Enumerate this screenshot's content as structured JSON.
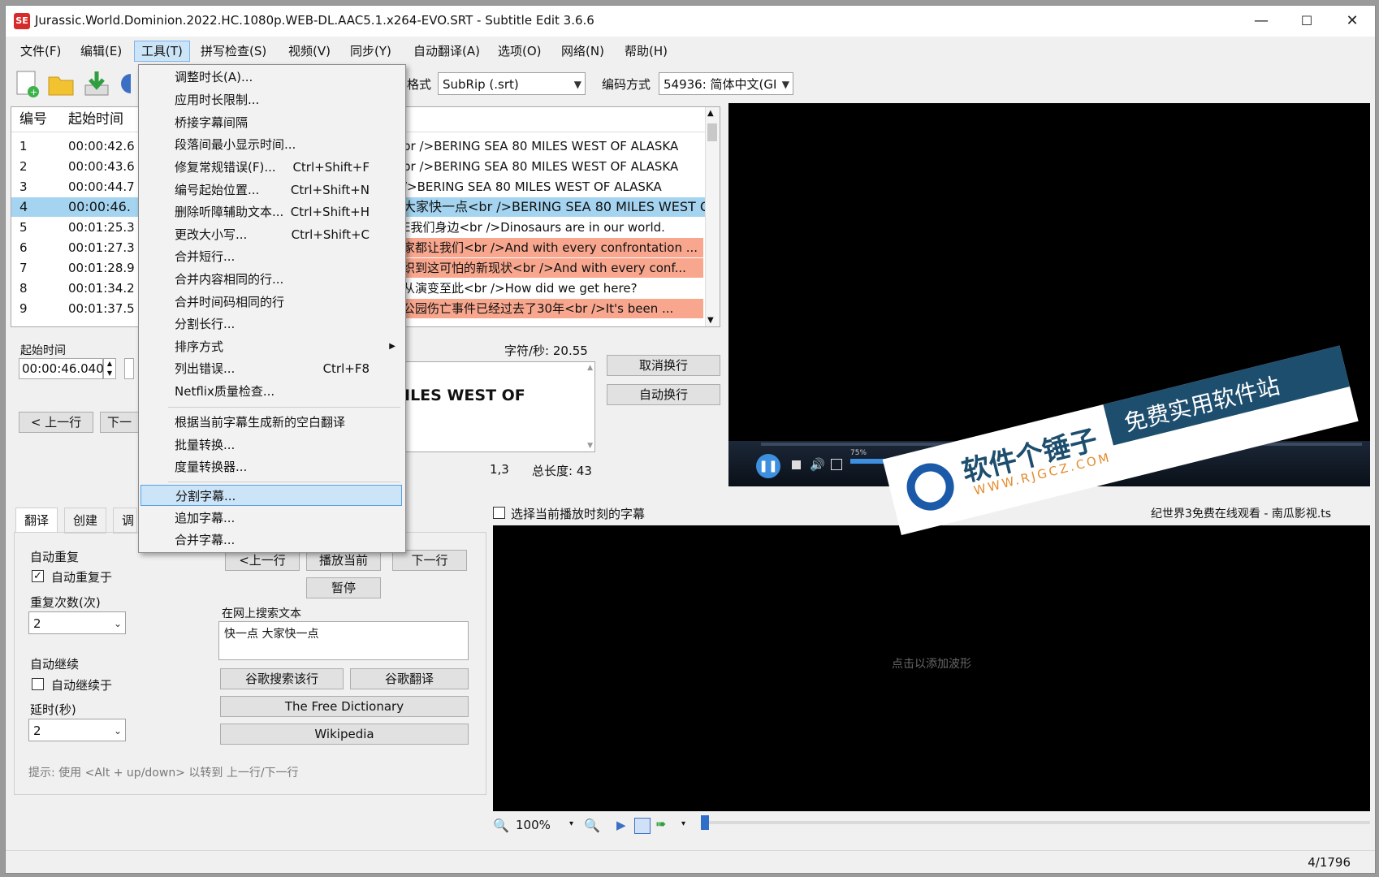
{
  "window": {
    "title": "Jurassic.World.Dominion.2022.HC.1080p.WEB-DL.AAC5.1.x264-EVO.SRT - Subtitle Edit 3.6.6",
    "app_icon_text": "SE",
    "minimize": "—",
    "maximize": "☐",
    "close": "✕"
  },
  "menubar": [
    "文件(F)",
    "编辑(E)",
    "工具(T)",
    "拼写检查(S)",
    "视频(V)",
    "同步(Y)",
    "自动翻译(A)",
    "选项(O)",
    "网络(N)",
    "帮助(H)"
  ],
  "toolbar": {
    "format_label": "格式",
    "format_value": "SubRip (.srt)",
    "encoding_label": "编码方式",
    "encoding_value": "54936: 简体中文(GI"
  },
  "grid": {
    "headers": [
      "编号",
      "起始时间"
    ],
    "rows": [
      {
        "num": "1",
        "start": "00:00:42.6",
        "text": "br />BERING SEA 80 MILES WEST OF ALASKA",
        "style": "normal"
      },
      {
        "num": "2",
        "start": "00:00:43.6",
        "text": "br />BERING SEA 80 MILES WEST OF ALASKA",
        "style": "normal"
      },
      {
        "num": "3",
        "start": "00:00:44.7",
        "text": "/>BERING SEA 80 MILES WEST OF ALASKA",
        "style": "normal"
      },
      {
        "num": "4",
        "start": "00:00:46.",
        "text": "大家快一点<br />BERING SEA 80 MILES WEST O",
        "style": "selected"
      },
      {
        "num": "5",
        "start": "00:01:25.3",
        "text": "E我们身边<br />Dinosaurs are in our world.",
        "style": "normal"
      },
      {
        "num": "6",
        "start": "00:01:27.3",
        "text": "家都让我们<br />And with every confrontation ...",
        "style": "red"
      },
      {
        "num": "7",
        "start": "00:01:28.9",
        "text": "织到这可怕的新现状<br />And with every conf...",
        "style": "red"
      },
      {
        "num": "8",
        "start": "00:01:34.2",
        "text": "从演变至此<br />How did we get here?",
        "style": "normal"
      },
      {
        "num": "9",
        "start": "00:01:37.5",
        "text": "公园伤亡事件已经过去了30年<br />It's been ...",
        "style": "red"
      }
    ]
  },
  "edit": {
    "start_label": "起始时间",
    "start_value": "00:00:46.040",
    "chars_per_sec": "字符/秒: 20.55",
    "text_preview": "ILES WEST OF",
    "position": "1,3",
    "total_length": "总长度: 43",
    "unbreak_button": "取消换行",
    "autobreak_button": "自动换行",
    "prev_button": "< 上一行",
    "next_button": "下一"
  },
  "tabs": [
    "翻译",
    "创建",
    "调"
  ],
  "translate": {
    "auto_repeat_title": "自动重复",
    "auto_repeat_check": "自动重复于",
    "repeat_count_label": "重复次数(次)",
    "repeat_count_value": "2",
    "auto_continue_title": "自动继续",
    "auto_continue_check": "自动继续于",
    "delay_label": "延时(秒)",
    "delay_value": "2",
    "prev_line": "<上一行",
    "play_current": "播放当前",
    "next_line": "下一行",
    "pause": "暂停",
    "search_web_title": "在网上搜索文本",
    "search_text": "快一点 大家快一点",
    "google_search": "谷歌搜索该行",
    "google_translate": "谷歌翻译",
    "free_dictionary": "The Free Dictionary",
    "wikipedia": "Wikipedia",
    "hint": "提示: 使用 <Alt + up/down> 以转到 上一行/下一行"
  },
  "waveform": {
    "select_current_label": "选择当前播放时刻的字幕",
    "file_name": "纪世界3免费在线观看 - 南瓜影视.ts",
    "click_to_add": "点击以添加波形",
    "zoom": "100%"
  },
  "status": {
    "position": "4/1796"
  },
  "video": {
    "volume_text": "75%"
  },
  "tools_menu": {
    "items": [
      {
        "label": "调整时长(A)...",
        "shortcut": ""
      },
      {
        "label": "应用时长限制...",
        "shortcut": ""
      },
      {
        "label": "桥接字幕间隔",
        "shortcut": ""
      },
      {
        "label": "段落间最小显示时间...",
        "shortcut": ""
      },
      {
        "label": "修复常规错误(F)...",
        "shortcut": "Ctrl+Shift+F"
      },
      {
        "label": "编号起始位置...",
        "shortcut": "Ctrl+Shift+N"
      },
      {
        "label": "删除听障辅助文本...",
        "shortcut": "Ctrl+Shift+H"
      },
      {
        "label": "更改大小写...",
        "shortcut": "Ctrl+Shift+C"
      },
      {
        "label": "合并短行...",
        "shortcut": ""
      },
      {
        "label": "合并内容相同的行...",
        "shortcut": ""
      },
      {
        "label": "合并时间码相同的行",
        "shortcut": ""
      },
      {
        "label": "分割长行...",
        "shortcut": ""
      },
      {
        "label": "排序方式",
        "shortcut": ""
      },
      {
        "label": "列出错误...",
        "shortcut": "Ctrl+F8"
      },
      {
        "label": "Netflix质量检查...",
        "shortcut": ""
      },
      {
        "label": "根据当前字幕生成新的空白翻译",
        "shortcut": ""
      },
      {
        "label": "批量转换...",
        "shortcut": ""
      },
      {
        "label": "度量转换器...",
        "shortcut": ""
      },
      {
        "label": "分割字幕...",
        "shortcut": ""
      },
      {
        "label": "追加字幕...",
        "shortcut": ""
      },
      {
        "label": "合并字幕...",
        "shortcut": ""
      }
    ]
  },
  "watermark": {
    "brand": "软件个锤子",
    "url": "WWW.RJGCZ.COM",
    "slogan": "免费实用软件站"
  },
  "colors": {
    "selected_row": "#a4d4f0",
    "error_row": "#f8a78e",
    "menu_highlight": "#cce4f7"
  }
}
